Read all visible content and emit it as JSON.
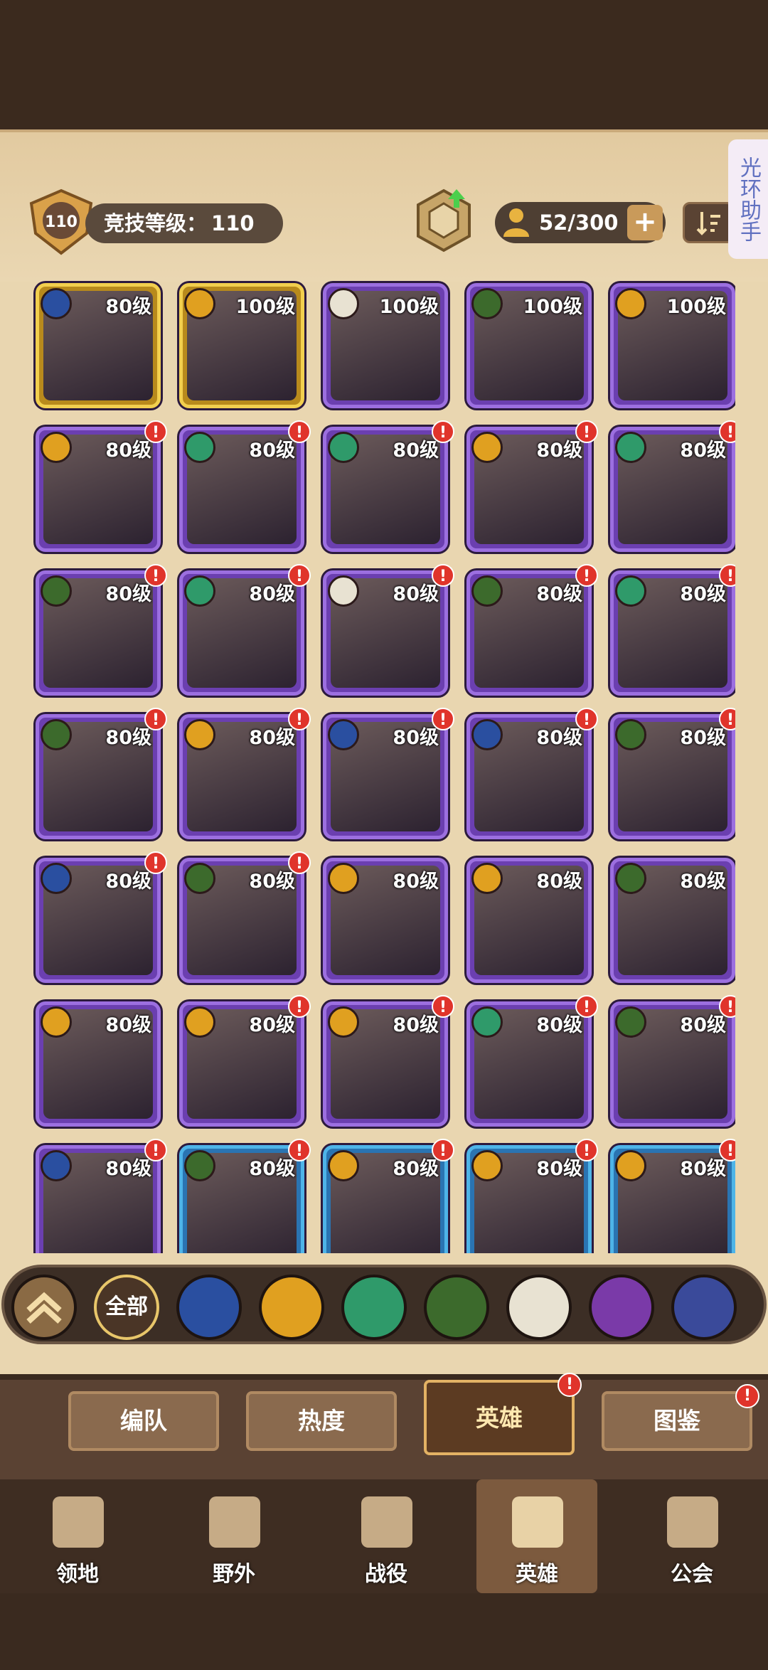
{
  "header": {
    "rank_level": "110",
    "rank_label": "竞技等级：",
    "rank_value": "110",
    "population": "52/300",
    "assistant": "光环助手",
    "plus_icon": "plus-icon"
  },
  "heroes": [
    {
      "level": "80级",
      "frame": "gold",
      "faction": "lightbearer",
      "alert": false
    },
    {
      "level": "100级",
      "frame": "gold",
      "faction": "mauler",
      "alert": false
    },
    {
      "level": "100级",
      "frame": "purple",
      "faction": "celestial",
      "alert": false
    },
    {
      "level": "100级",
      "frame": "purple",
      "faction": "graveborn",
      "alert": false
    },
    {
      "level": "100级",
      "frame": "purple",
      "faction": "mauler",
      "alert": false
    },
    {
      "level": "80级",
      "frame": "purple",
      "faction": "mauler",
      "alert": true
    },
    {
      "level": "80级",
      "frame": "purple",
      "faction": "wilder",
      "alert": true
    },
    {
      "level": "80级",
      "frame": "purple",
      "faction": "wilder",
      "alert": true
    },
    {
      "level": "80级",
      "frame": "purple",
      "faction": "mauler",
      "alert": true
    },
    {
      "level": "80级",
      "frame": "purple",
      "faction": "wilder",
      "alert": true
    },
    {
      "level": "80级",
      "frame": "purple",
      "faction": "graveborn",
      "alert": true
    },
    {
      "level": "80级",
      "frame": "purple",
      "faction": "wilder",
      "alert": true
    },
    {
      "level": "80级",
      "frame": "purple",
      "faction": "celestial",
      "alert": true
    },
    {
      "level": "80级",
      "frame": "purple",
      "faction": "graveborn",
      "alert": true
    },
    {
      "level": "80级",
      "frame": "purple",
      "faction": "wilder",
      "alert": true
    },
    {
      "level": "80级",
      "frame": "purple",
      "faction": "graveborn",
      "alert": true
    },
    {
      "level": "80级",
      "frame": "purple",
      "faction": "mauler",
      "alert": true
    },
    {
      "level": "80级",
      "frame": "purple",
      "faction": "lightbearer",
      "alert": true
    },
    {
      "level": "80级",
      "frame": "purple",
      "faction": "lightbearer",
      "alert": true
    },
    {
      "level": "80级",
      "frame": "purple",
      "faction": "graveborn",
      "alert": true
    },
    {
      "level": "80级",
      "frame": "purple",
      "faction": "lightbearer",
      "alert": true
    },
    {
      "level": "80级",
      "frame": "purple",
      "faction": "graveborn",
      "alert": true
    },
    {
      "level": "80级",
      "frame": "purple",
      "faction": "mauler",
      "alert": false
    },
    {
      "level": "80级",
      "frame": "purple",
      "faction": "mauler",
      "alert": false
    },
    {
      "level": "80级",
      "frame": "purple",
      "faction": "graveborn",
      "alert": false
    },
    {
      "level": "80级",
      "frame": "purple",
      "faction": "mauler",
      "alert": false
    },
    {
      "level": "80级",
      "frame": "purple",
      "faction": "mauler",
      "alert": true
    },
    {
      "level": "80级",
      "frame": "purple",
      "faction": "mauler",
      "alert": true
    },
    {
      "level": "80级",
      "frame": "purple",
      "faction": "wilder",
      "alert": true
    },
    {
      "level": "80级",
      "frame": "purple",
      "faction": "graveborn",
      "alert": true
    },
    {
      "level": "80级",
      "frame": "purple",
      "faction": "lightbearer",
      "alert": true
    },
    {
      "level": "80级",
      "frame": "blue",
      "faction": "graveborn",
      "alert": true
    },
    {
      "level": "80级",
      "frame": "blue",
      "faction": "mauler",
      "alert": true
    },
    {
      "level": "80级",
      "frame": "blue",
      "faction": "mauler",
      "alert": true
    },
    {
      "level": "80级",
      "frame": "blue",
      "faction": "mauler",
      "alert": true
    }
  ],
  "filters": [
    {
      "name": "collapse",
      "label": ""
    },
    {
      "name": "all",
      "label": "全部"
    },
    {
      "name": "lightbearer",
      "label": ""
    },
    {
      "name": "mauler",
      "label": ""
    },
    {
      "name": "wilder",
      "label": ""
    },
    {
      "name": "graveborn",
      "label": ""
    },
    {
      "name": "celestial",
      "label": ""
    },
    {
      "name": "hypogean",
      "label": ""
    },
    {
      "name": "dimensional",
      "label": ""
    }
  ],
  "faction_colors": {
    "lightbearer": "#2a4fa0",
    "mauler": "#e0a020",
    "wilder": "#2f9a6a",
    "graveborn": "#3c6a2c",
    "celestial": "#e8e2d2",
    "hypogean": "#7a3aa8",
    "dimensional": "#3a4a9a"
  },
  "tabs": [
    {
      "label": "编队",
      "active": false,
      "alert": false
    },
    {
      "label": "热度",
      "active": false,
      "alert": false
    },
    {
      "label": "英雄",
      "active": true,
      "alert": true
    },
    {
      "label": "图鉴",
      "active": false,
      "alert": true
    }
  ],
  "nav": [
    {
      "label": "领地",
      "active": false
    },
    {
      "label": "野外",
      "active": false
    },
    {
      "label": "战役",
      "active": false
    },
    {
      "label": "英雄",
      "active": true
    },
    {
      "label": "公会",
      "active": false
    }
  ]
}
